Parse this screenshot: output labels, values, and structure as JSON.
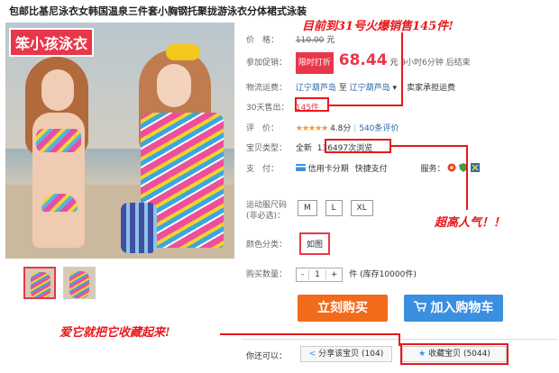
{
  "title": "包邮比基尼泳衣女韩国温泉三件套小胸钢托聚拢游泳衣分体裙式泳装",
  "image": {
    "brand_tag": "笨小孩泳衣"
  },
  "price": {
    "label": "价　格：",
    "value": "110.00",
    "unit": "元"
  },
  "promo": {
    "label": "参加促销：",
    "badge": "限时打折",
    "value": "68.44",
    "unit": "元",
    "countdown": "9小时6分钟 后结束"
  },
  "shipping": {
    "label": "物流运费：",
    "from": "辽宁葫芦岛",
    "sep": "至",
    "to": "辽宁葫芦岛",
    "note": "卖家承担运费"
  },
  "sales": {
    "label": "30天售出：",
    "value": "145件"
  },
  "rating": {
    "label": "评　价：",
    "stars": "★★★★★",
    "score": "4.8分",
    "sep": "|",
    "count": "540条评价"
  },
  "type": {
    "label": "宝贝类型：",
    "value": "全新",
    "views": "136497次浏览"
  },
  "payment": {
    "label": "支　付：",
    "credit": "信用卡分期",
    "quick": "快捷支付",
    "service_label": "服务："
  },
  "size": {
    "label": "运动服尺码",
    "sublabel": "(非必选)：",
    "options": [
      "M",
      "L",
      "XL"
    ]
  },
  "color": {
    "label": "颜色分类：",
    "option": "如图"
  },
  "quantity": {
    "label": "购买数量：",
    "minus": "-",
    "value": "1",
    "plus": "+",
    "unit": "件",
    "stock": "(库存10000件)"
  },
  "buttons": {
    "buy": "立刻购买",
    "cart": "加入购物车"
  },
  "share": {
    "label": "你还可以：",
    "share_btn": "分享该宝贝 (104)",
    "fav_btn": "收藏宝贝 (5044)"
  },
  "annotations": {
    "sales_note": "目前到31号火爆销售145件!",
    "views_note": "超高人气！！",
    "fav_note": "爱它就把它收藏起来!"
  },
  "colors": {
    "accent": "#e8374a",
    "buy": "#f26b1b",
    "cart": "#3a8fe0",
    "annotation": "#e8181b"
  }
}
